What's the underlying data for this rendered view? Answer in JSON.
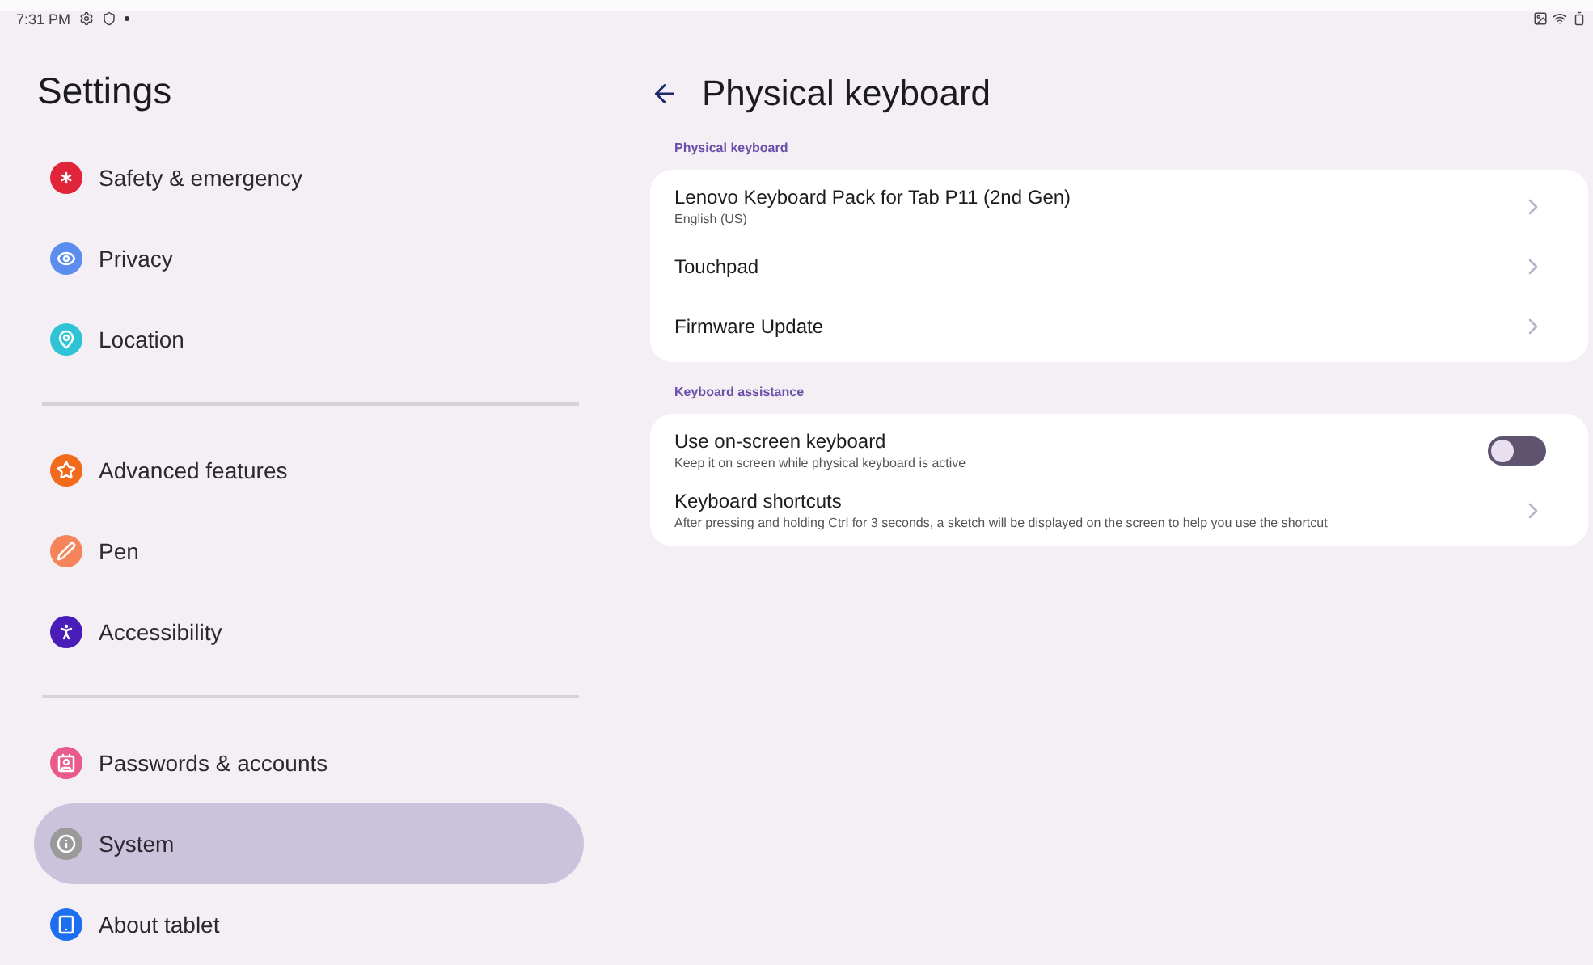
{
  "status_bar": {
    "time": "7:31 PM"
  },
  "sidebar": {
    "title": "Settings",
    "groups": [
      {
        "items": [
          {
            "label": "Safety & emergency",
            "kind": "asterisk",
            "color": "#e0243a",
            "selected": false
          },
          {
            "label": "Privacy",
            "kind": "eye",
            "color": "#5b8def",
            "selected": false
          },
          {
            "label": "Location",
            "kind": "pin",
            "color": "#2ec4d6",
            "selected": false
          }
        ]
      },
      {
        "items": [
          {
            "label": "Advanced features",
            "kind": "star",
            "color": "#f26a1b",
            "selected": false
          },
          {
            "label": "Pen",
            "kind": "pen",
            "color": "#f5845a",
            "selected": false
          },
          {
            "label": "Accessibility",
            "kind": "person",
            "color": "#4a1cb8",
            "selected": false
          }
        ]
      },
      {
        "items": [
          {
            "label": "Passwords & accounts",
            "kind": "contact",
            "color": "#ea5a8a",
            "selected": false
          },
          {
            "label": "System",
            "kind": "info",
            "color": "#9a9a9a",
            "selected": true
          },
          {
            "label": "About tablet",
            "kind": "tablet",
            "color": "#1e6ff0",
            "selected": false
          }
        ]
      }
    ]
  },
  "page": {
    "title": "Physical keyboard",
    "sections": [
      {
        "heading": "Physical keyboard",
        "rows": [
          {
            "kind": "link",
            "title": "Lenovo Keyboard Pack for Tab P11 (2nd Gen)",
            "subtitle": "English (US)"
          },
          {
            "kind": "link",
            "title": "Touchpad"
          },
          {
            "kind": "link",
            "title": "Firmware Update"
          }
        ]
      },
      {
        "heading": "Keyboard assistance",
        "rows": [
          {
            "kind": "switch",
            "title": "Use on-screen keyboard",
            "subtitle": "Keep it on screen while physical keyboard is active",
            "on": false
          },
          {
            "kind": "link",
            "title": "Keyboard shortcuts",
            "subtitle": "After pressing and holding Ctrl for 3 seconds, a sketch will be displayed on the screen to help you use the shortcut"
          }
        ]
      }
    ]
  }
}
